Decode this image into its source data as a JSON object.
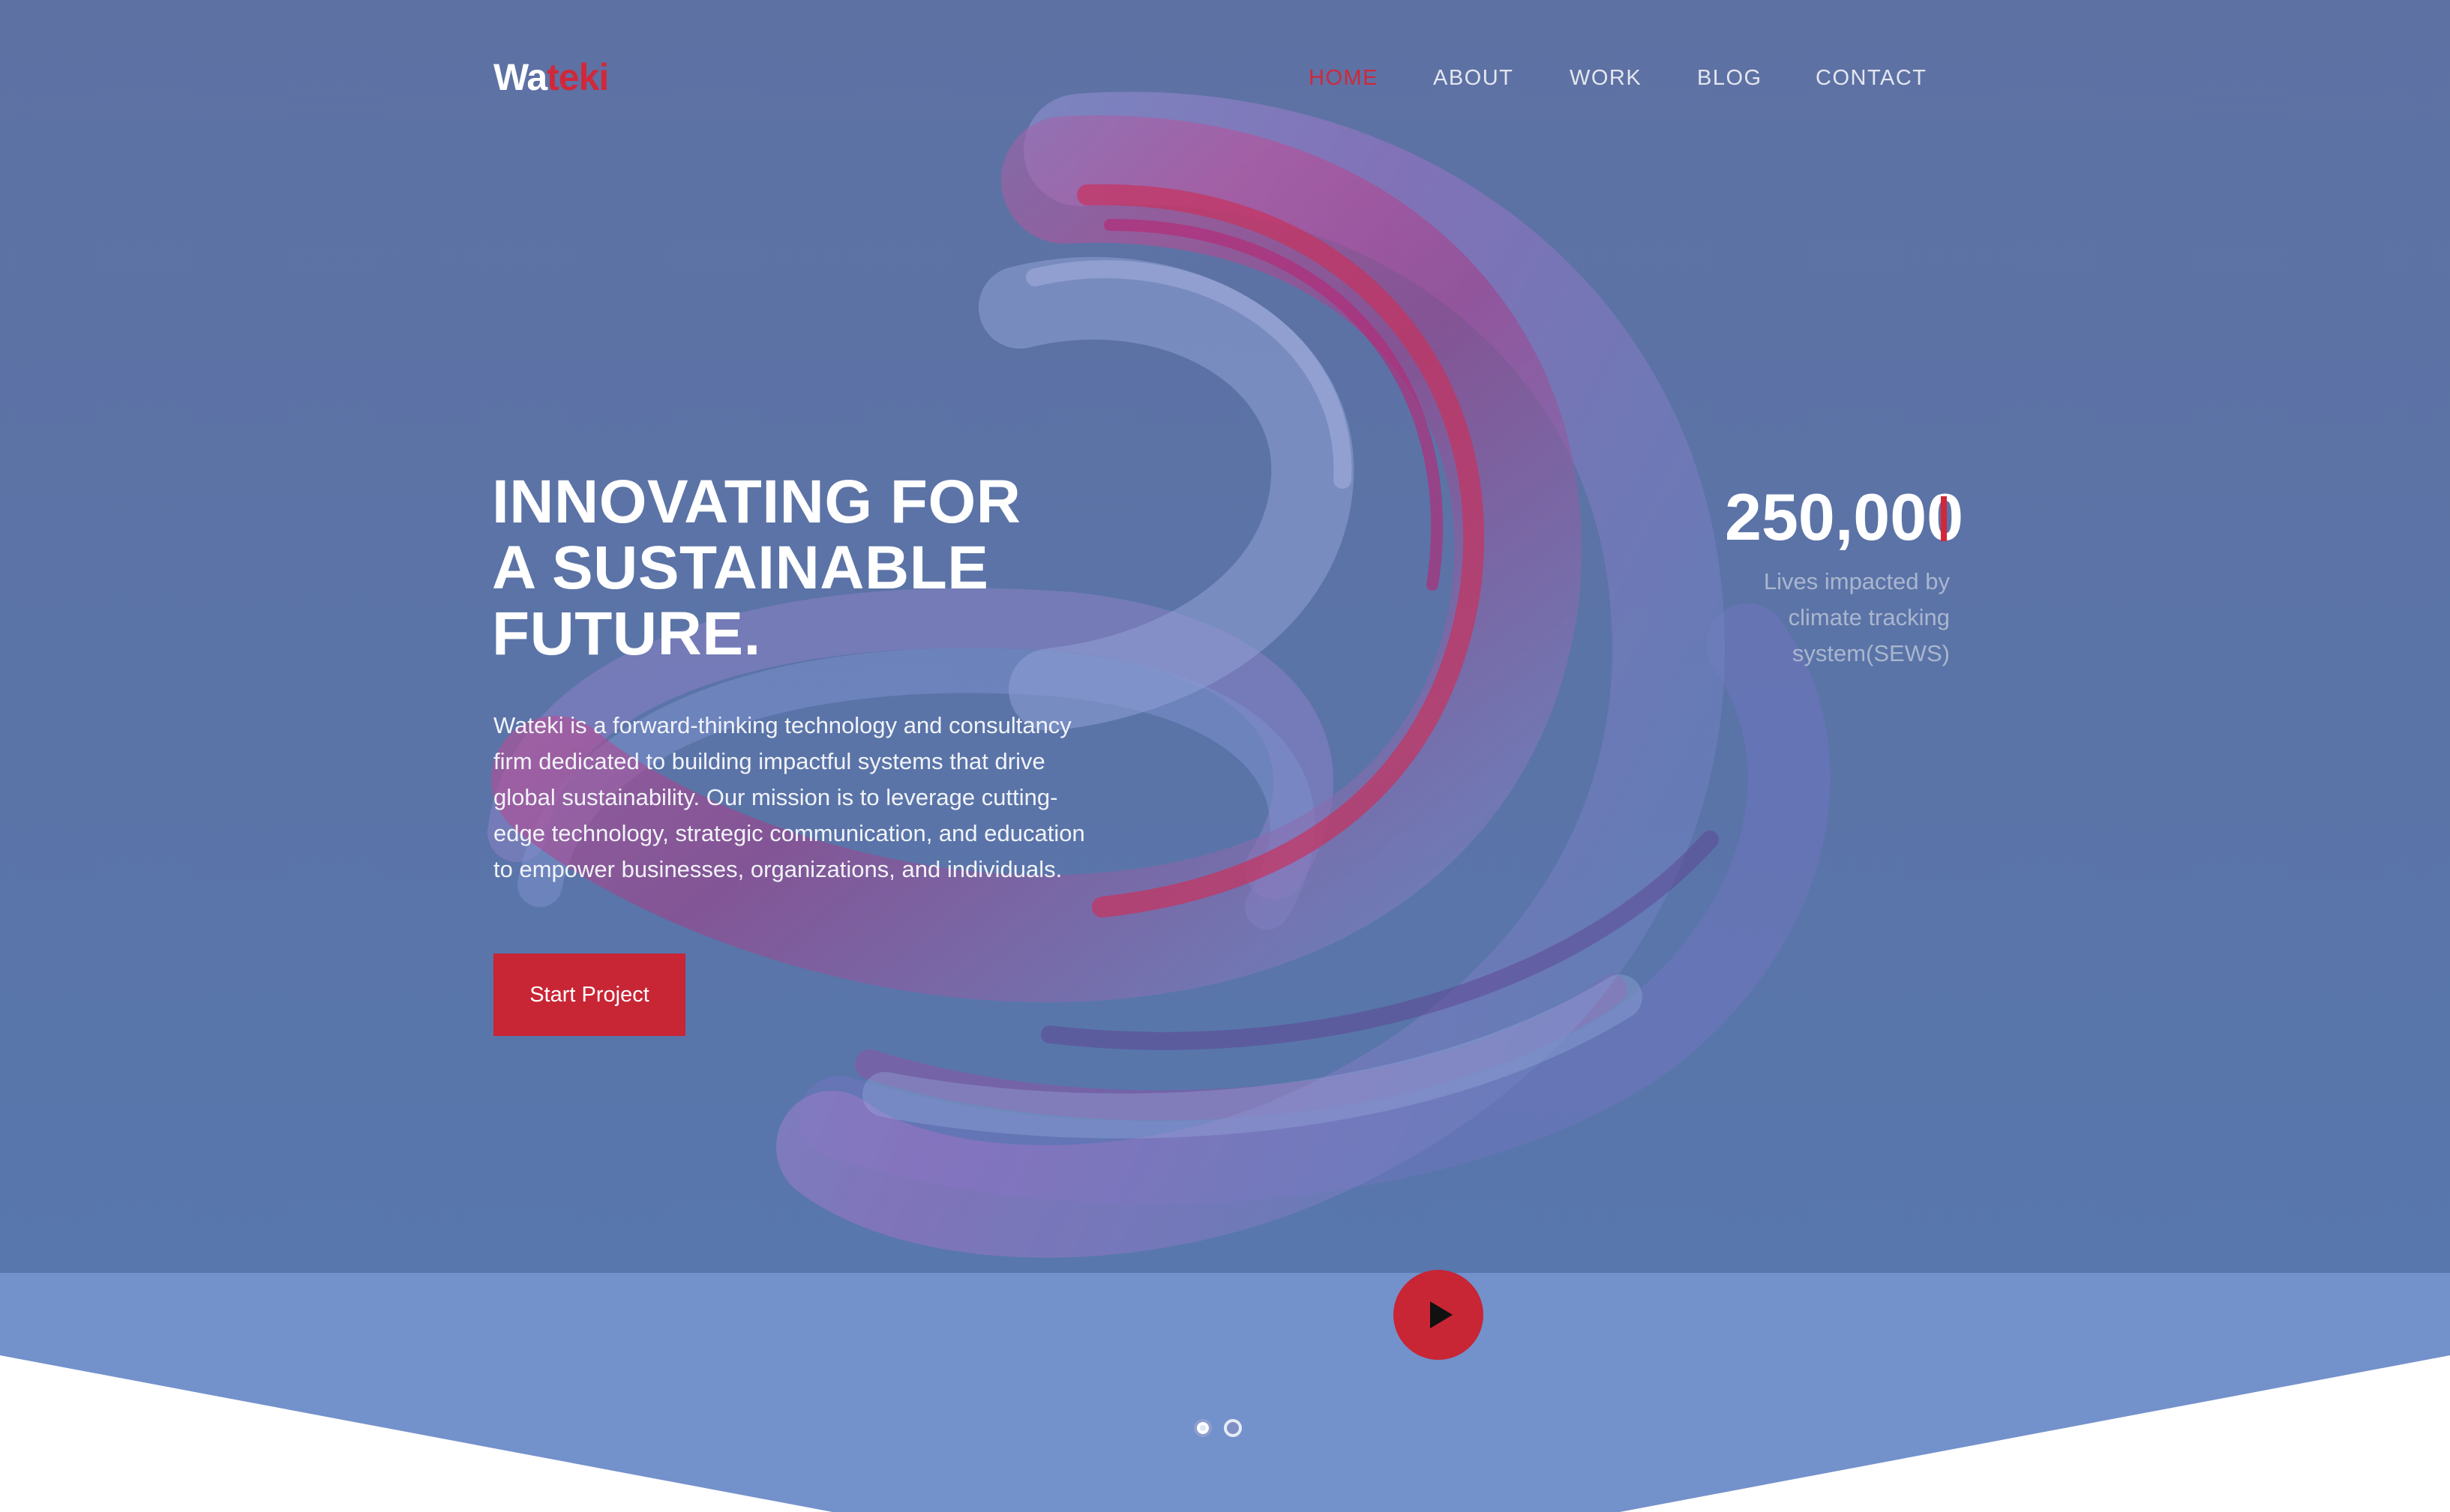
{
  "brand": {
    "logo_primary": "Wa",
    "logo_accent": "teki",
    "accent_color": "#c82535"
  },
  "nav": {
    "items": [
      {
        "label": "HOME",
        "active": true
      },
      {
        "label": "ABOUT",
        "active": false
      },
      {
        "label": "WORK",
        "active": false
      },
      {
        "label": "BLOG",
        "active": false
      },
      {
        "label": "CONTACT",
        "active": false
      }
    ]
  },
  "hero": {
    "headline": [
      "INNOVATING FOR",
      "A SUSTAINABLE",
      "FUTURE."
    ],
    "description": "Wateki is a forward-thinking technology and consultancy firm dedicated to building impactful systems that drive global sustainability. Our mission is to leverage cutting-edge technology, strategic communication, and education to empower businesses, organizations, and individuals.",
    "cta_label": "Start Project"
  },
  "stat": {
    "value": "250,000",
    "label": "Lives impacted by climate tracking system(SEWS)"
  },
  "media": {
    "play_icon": "play-icon"
  },
  "slider": {
    "total_slides": 2,
    "active_slide": 1
  }
}
